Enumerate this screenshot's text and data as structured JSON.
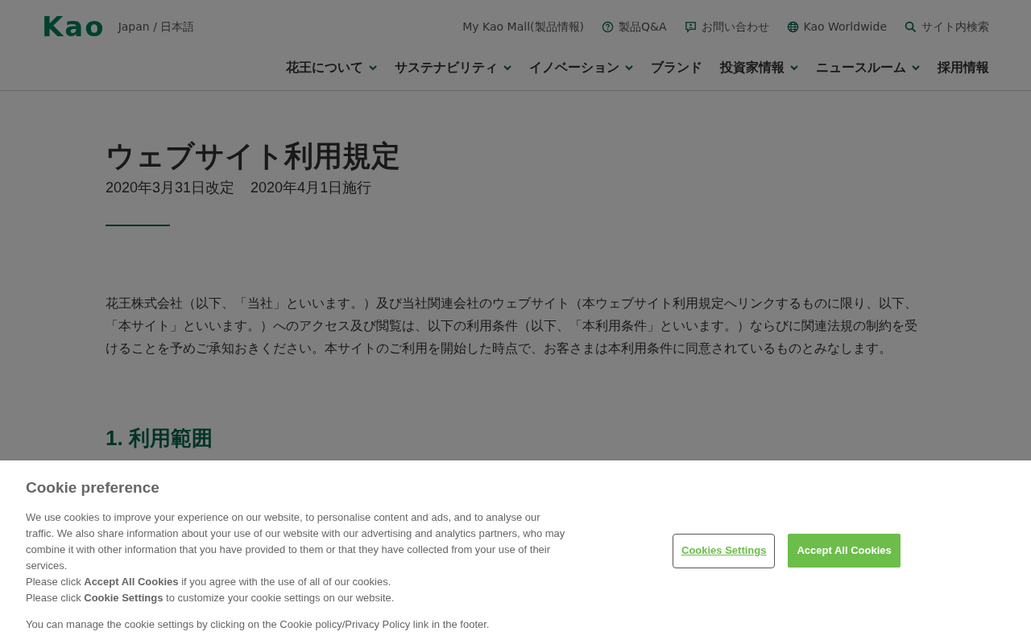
{
  "header": {
    "logo_text": "Kao",
    "language": "Japan / 日本語",
    "utility_links": [
      {
        "label": "My Kao Mall(製品情報)",
        "kind": "plain"
      },
      {
        "label": "製品Q&A",
        "kind": "help"
      },
      {
        "label": "お問い合わせ",
        "kind": "contact"
      },
      {
        "label": "Kao Worldwide",
        "kind": "global"
      },
      {
        "label": "サイト内検索",
        "kind": "search"
      }
    ],
    "nav": [
      {
        "label": "花王について",
        "has_dropdown": true
      },
      {
        "label": "サステナビリティ",
        "has_dropdown": true
      },
      {
        "label": "イノベーション",
        "has_dropdown": true
      },
      {
        "label": "ブランド",
        "has_dropdown": false
      },
      {
        "label": "投資家情報",
        "has_dropdown": true
      },
      {
        "label": "ニュースルーム",
        "has_dropdown": true
      },
      {
        "label": "採用情報",
        "has_dropdown": false
      }
    ]
  },
  "page": {
    "title": "ウェブサイト利用規定",
    "dates": [
      "2020年3月31日改定",
      "2020年4月1日施行"
    ],
    "intro": "花王株式会社（以下、「当社」といいます。）及び当社関連会社のウェブサイト（本ウェブサイト利用規定へリンクするものに限り、以下、「本サイト」といいます。）へのアクセス及び閲覧は、以下の利用条件（以下、「本利用条件」といいます。）ならびに関連法規の制約を受けることを予めご承知おきください。本サイトのご利用を開始した時点で、お客さまは本利用条件に同意されているものとみなします。",
    "section_heading": "1. 利用範囲"
  },
  "cookie_banner": {
    "title": "Cookie preference",
    "paragraphs": [
      "We use cookies to improve your experience on our website, to personalise content and ads, and to analyse our traffic. We also share information about your use of our website with our advertising and analytics partners, who may combine it with other information that you have provided to them or that they have collected from your use of their services.",
      "Please click **Accept All Cookies** if you agree with the use of all of our cookies.",
      "Please click **Cookie Settings** to customize your cookie settings on our website."
    ],
    "footer_note": "You can manage the cookie settings by clicking on the Cookie policy/Privacy Policy link in the footer.",
    "buttons": [
      {
        "label": "Cookies Settings",
        "kind": "secondary"
      },
      {
        "label": "Accept All Cookies",
        "kind": "primary"
      }
    ]
  }
}
